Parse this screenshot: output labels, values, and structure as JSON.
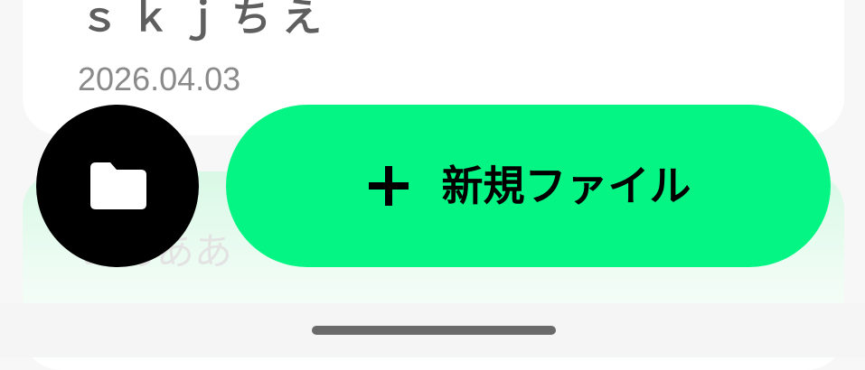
{
  "card": {
    "title": "ｓｋｊちえ",
    "date": "2026.04.03"
  },
  "next_card": {
    "title": "ああああ"
  },
  "fab": {
    "folder_icon": "folder-icon",
    "new_file_label": "新規ファイル",
    "plus_icon": "plus-icon"
  },
  "colors": {
    "accent": "#05f584",
    "folder_button": "#000000",
    "card_background": "#ffffff",
    "title_text": "#5f5f5f",
    "date_text": "#8a8a8a"
  }
}
